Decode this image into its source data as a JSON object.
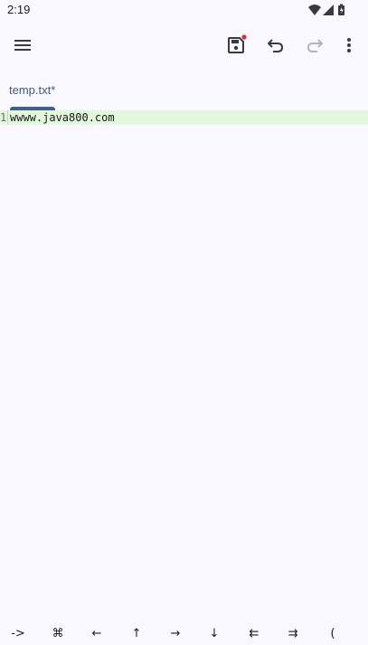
{
  "status_bar": {
    "time": "2:19",
    "icons": [
      "wifi-icon",
      "cell-signal-icon",
      "battery-icon"
    ]
  },
  "toolbar": {
    "icons": [
      "menu-icon",
      "save-icon",
      "undo-icon",
      "redo-icon",
      "more-vert-icon"
    ],
    "save_unsaved_dot_color": "#d32f2f"
  },
  "tabs": [
    {
      "label": "temp.txt*",
      "active": true
    }
  ],
  "editor": {
    "lines": [
      {
        "number": "1",
        "text": "wwww.java800.com"
      }
    ],
    "current_line_color": "#e2f6dc"
  },
  "symbol_bar": {
    "keys": [
      "->",
      "⌘",
      "←",
      "↑",
      "→",
      "↓",
      "⇇",
      "⇉",
      "("
    ]
  },
  "colors": {
    "background": "#f9f7ff",
    "accent": "#3f5f90"
  }
}
